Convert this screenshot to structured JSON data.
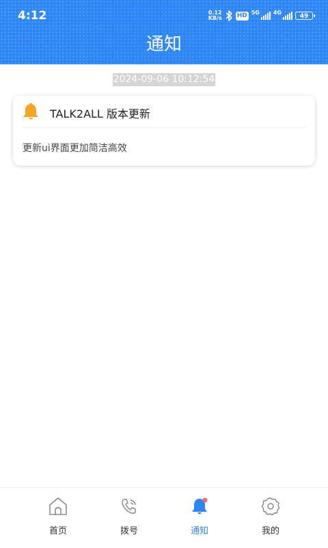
{
  "status_bar": {
    "time": "4:12",
    "net_speed_value": "0.12",
    "net_speed_unit": "KB/s",
    "hd_badge": "HD",
    "network_1": "5G",
    "network_2": "4G",
    "battery": "49"
  },
  "header": {
    "title": "通知"
  },
  "notifications": [
    {
      "timestamp": "2024-09-06 10:12:54",
      "title": "TALK2ALL 版本更新",
      "body": "更新ui界面更加简洁高效",
      "icon": "bell-icon"
    }
  ],
  "tabbar": {
    "items": [
      {
        "label": "首页",
        "icon": "home-icon",
        "active": false
      },
      {
        "label": "拨号",
        "icon": "phone-icon",
        "active": false
      },
      {
        "label": "通知",
        "icon": "bell-icon",
        "active": true
      },
      {
        "label": "我的",
        "icon": "gear-icon",
        "active": false
      }
    ]
  },
  "colors": {
    "accent": "#2e86f5",
    "notification_dot": "#f26b6b",
    "bell": "#f5a623",
    "timestamp_bg": "#d4d4d4"
  }
}
